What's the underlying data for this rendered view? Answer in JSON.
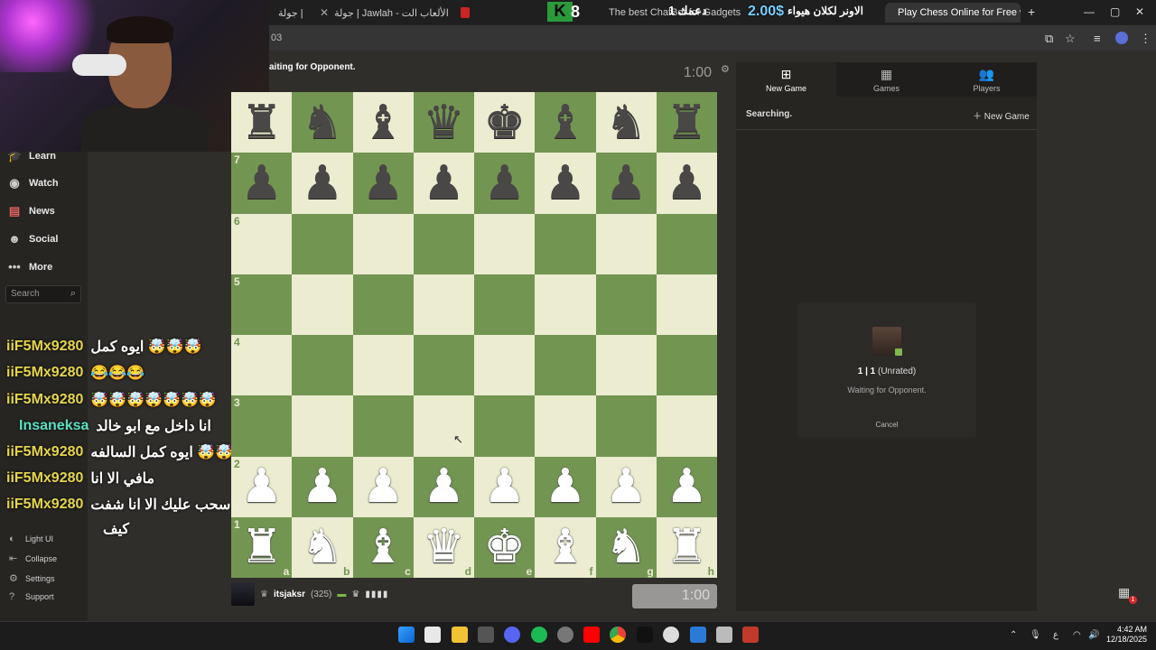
{
  "browser": {
    "tabs": [
      {
        "label": "جولة |",
        "active": false
      },
      {
        "label": "جولة | Jawlah - منصة الألعاب الت...",
        "active": false
      },
      {
        "label": "",
        "active": false
      },
      {
        "label": "The best ChatBot for Gadgets",
        "active": false
      },
      {
        "label": "Play Chess Online for Free with",
        "active": true
      }
    ],
    "overlay_text": "الاونر لكلان هيواء",
    "overlay_amount": "2.00$",
    "overlay_suffix": "1 دعمك",
    "overlay_k8": "8",
    "url": "03"
  },
  "nav": {
    "items": [
      {
        "label": "Learn",
        "icon": "learn-icon"
      },
      {
        "label": "Watch",
        "icon": "watch-icon"
      },
      {
        "label": "News",
        "icon": "news-icon"
      },
      {
        "label": "Social",
        "icon": "social-icon"
      },
      {
        "label": "More",
        "icon": "more-icon"
      }
    ],
    "search_placeholder": "Search",
    "footer": [
      {
        "label": "Light UI"
      },
      {
        "label": "Collapse"
      },
      {
        "label": "Settings"
      },
      {
        "label": "Support"
      }
    ]
  },
  "chat": [
    {
      "user": "iiF5Mx9280",
      "msg": "ايوه كمل 🤯🤯🤯"
    },
    {
      "user": "iiF5Mx9280",
      "msg": "😂😂😂"
    },
    {
      "user": "iiF5Mx9280",
      "msg": "🤯🤯🤯🤯🤯🤯🤯"
    },
    {
      "user": "Insaneksa",
      "msg": "انا داخل مع ابو خالد"
    },
    {
      "user": "iiF5Mx9280",
      "msg": "ايوه كمل السالفه 🤯🤯🤯"
    },
    {
      "user": "iiF5Mx9280",
      "msg": "مافي الا انا"
    },
    {
      "user": "iiF5Mx9280",
      "msg": "سحب عليك الا انا شفت"
    }
  ],
  "chat_continuation": "كيف",
  "game": {
    "status": "aiting for Opponent.",
    "clock_top": "1:00",
    "clock_bottom": "1:00",
    "player_name": "itsjaksr",
    "player_rating": "(325)",
    "ranks": [
      "7",
      "6",
      "5",
      "4",
      "3",
      "2",
      "1"
    ],
    "files": [
      "a",
      "b",
      "c",
      "d",
      "e",
      "f",
      "g",
      "h"
    ]
  },
  "panel": {
    "tabs": [
      {
        "label": "New Game",
        "icon": "plus-square-icon"
      },
      {
        "label": "Games",
        "icon": "board-icon"
      },
      {
        "label": "Players",
        "icon": "players-icon"
      }
    ],
    "searching": "Searching.",
    "new_game_link": "New Game",
    "seek_time": "1 | 1",
    "seek_type": "(Unrated)",
    "seek_status": "Waiting for Opponent.",
    "cancel_label": "Cancel"
  },
  "taskbar": {
    "time": "4:42 AM",
    "date": "12/18/2025",
    "lang": "ع"
  }
}
